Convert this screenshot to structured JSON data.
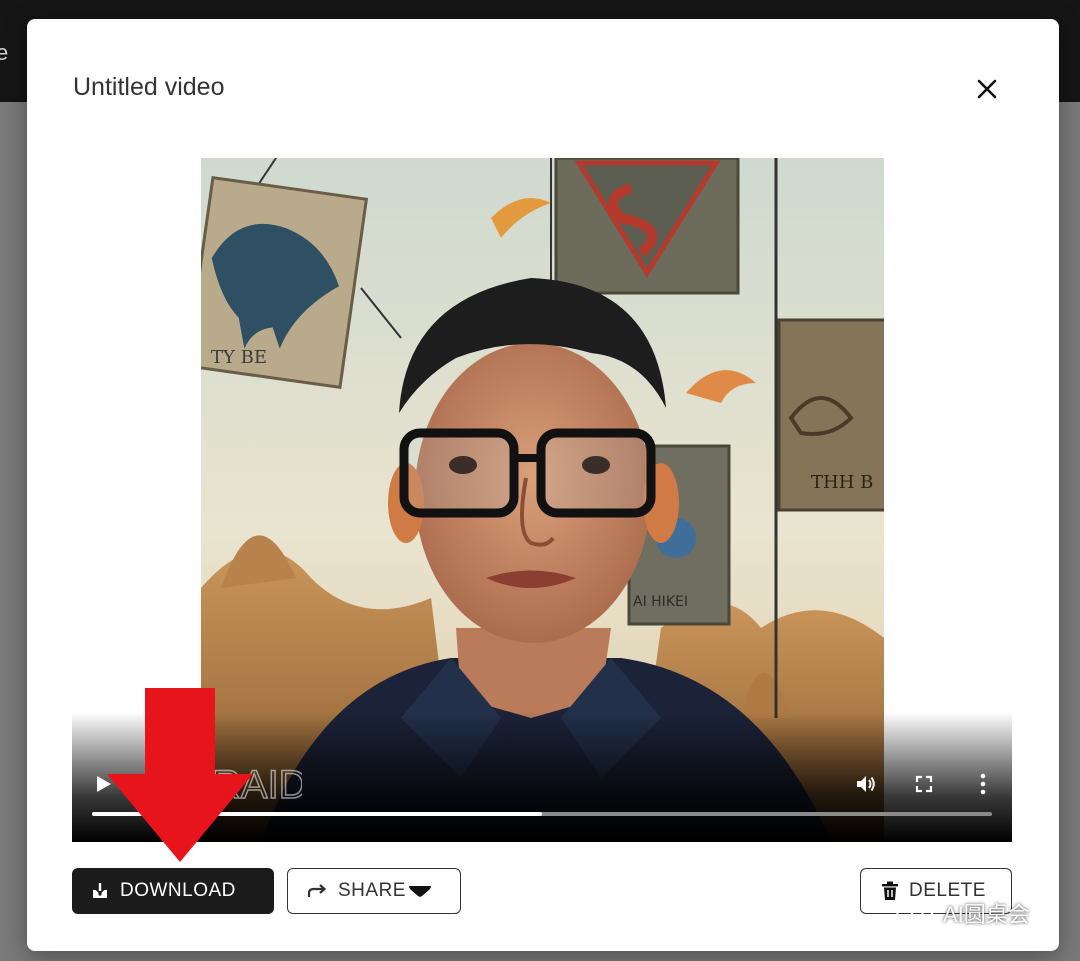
{
  "backdrop": {
    "edge_text": "e"
  },
  "modal": {
    "title": "Untitled video",
    "close_label": "Close",
    "video": {
      "overlay_text": "RAID",
      "banner_texts": [
        "TY BE",
        "THH B",
        "AI HIKEI"
      ],
      "progress": 0.5
    },
    "actions": {
      "download": "DOWNLOAD",
      "share": "SHARE",
      "delete": "DELETE"
    }
  },
  "watermark": {
    "text": "AI圆桌会"
  },
  "colors": {
    "accent_dark": "#1c1c1c",
    "annotation_arrow": "#e8141b"
  },
  "icons": [
    "close-icon",
    "play-icon",
    "volume-icon",
    "fullscreen-icon",
    "more-vert-icon",
    "download-icon",
    "share-icon",
    "caret-down-icon",
    "trash-icon",
    "wechat-icon"
  ]
}
